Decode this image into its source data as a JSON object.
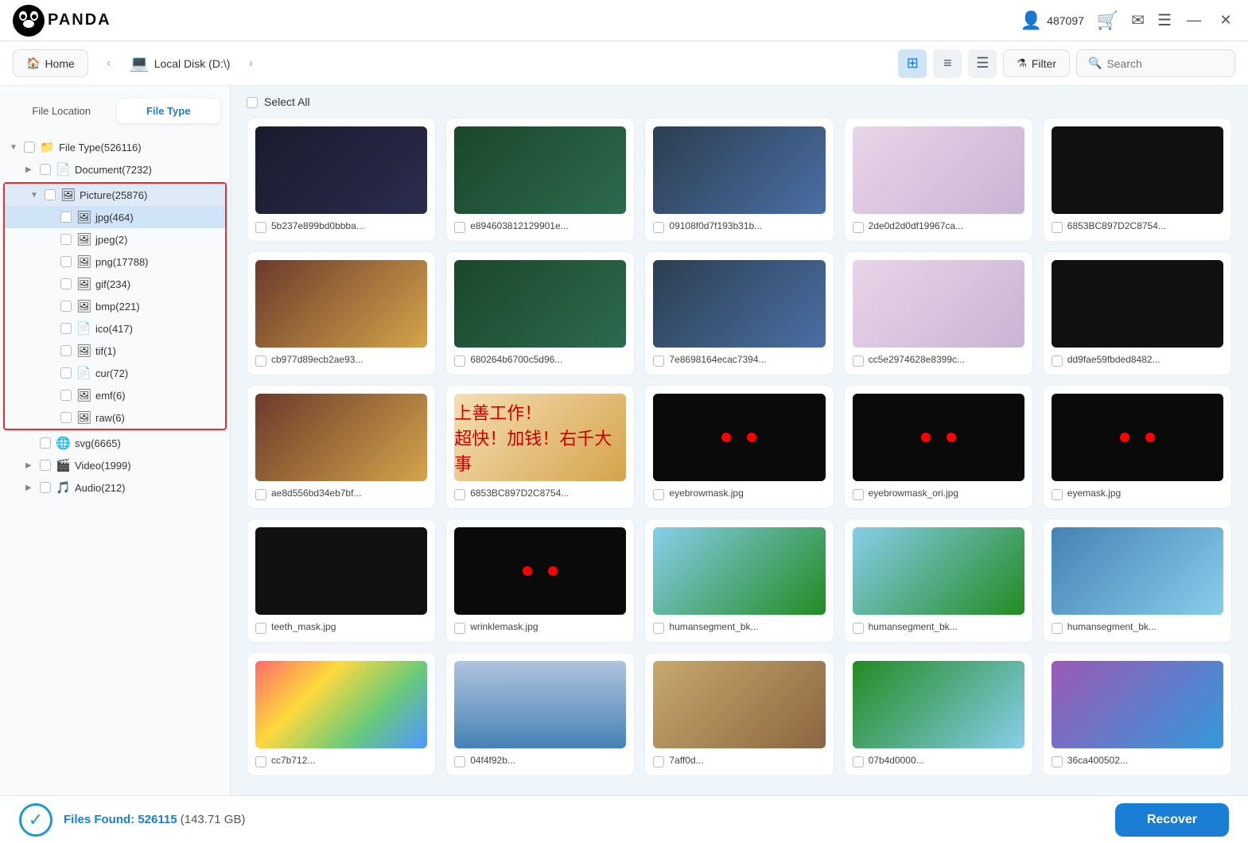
{
  "titlebar": {
    "logo_text": "PANDA",
    "user_id": "487097",
    "cart_icon": "🛒",
    "email_icon": "✉",
    "menu_icon": "☰",
    "minimize_icon": "—",
    "close_icon": "✕"
  },
  "navbar": {
    "home_label": "Home",
    "location_label": "Local Disk (D:\\)",
    "filter_label": "Filter",
    "search_placeholder": "Search"
  },
  "sidebar": {
    "tab_file_location": "File Location",
    "tab_file_type": "File Type",
    "tree": [
      {
        "id": "root",
        "label": "File Type(526116)",
        "indent": 0,
        "icon": "📁",
        "arrow": "▼",
        "color": "#f5c518"
      },
      {
        "id": "document",
        "label": "Document(7232)",
        "indent": 1,
        "icon": "📄",
        "arrow": "▶",
        "color": "#f5a623"
      },
      {
        "id": "picture",
        "label": "Picture(25876)",
        "indent": 1,
        "icon": "🖼",
        "arrow": "▼",
        "color": "#4a90d9",
        "selected": true
      },
      {
        "id": "jpg",
        "label": "jpg(464)",
        "indent": 2,
        "icon": "🖼",
        "highlighted": true
      },
      {
        "id": "jpeg",
        "label": "jpeg(2)",
        "indent": 2,
        "icon": "🖼"
      },
      {
        "id": "png",
        "label": "png(17788)",
        "indent": 2,
        "icon": "🖼",
        "color": "#4caf50"
      },
      {
        "id": "gif",
        "label": "gif(234)",
        "indent": 2,
        "icon": "🖼"
      },
      {
        "id": "bmp",
        "label": "bmp(221)",
        "indent": 2,
        "icon": "🖼"
      },
      {
        "id": "ico",
        "label": "ico(417)",
        "indent": 2,
        "icon": "📄"
      },
      {
        "id": "tif",
        "label": "tif(1)",
        "indent": 2,
        "icon": "🖼",
        "color": "#f5c518"
      },
      {
        "id": "cur",
        "label": "cur(72)",
        "indent": 2,
        "icon": "📄"
      },
      {
        "id": "emf",
        "label": "emf(6)",
        "indent": 2,
        "icon": "🖼"
      },
      {
        "id": "raw",
        "label": "raw(6)",
        "indent": 2,
        "icon": "🖼",
        "color": "#4a90d9"
      },
      {
        "id": "svg",
        "label": "svg(6665)",
        "indent": 1,
        "icon": "🌐",
        "color": "#e44d26"
      },
      {
        "id": "video",
        "label": "Video(1999)",
        "indent": 1,
        "icon": "🎬",
        "arrow": "▶",
        "color": "#9b59b6"
      },
      {
        "id": "audio",
        "label": "Audio(212)",
        "indent": 1,
        "icon": "🎵",
        "arrow": "▶",
        "color": "#e74c3c"
      }
    ]
  },
  "content": {
    "select_all_label": "Select All",
    "files": [
      {
        "name": "5b237e899bd0bbba...",
        "style": "img-dark"
      },
      {
        "name": "e894603812129901e...",
        "style": "img-nature"
      },
      {
        "name": "09108f0d7f193b31b...",
        "style": "img-city"
      },
      {
        "name": "2de0d2d0df19967ca...",
        "style": "img-abstract"
      },
      {
        "name": "6853BC897D2C8754...",
        "style": "img-black"
      },
      {
        "name": "cb977d89ecb2ae93...",
        "style": "img-art"
      },
      {
        "name": "680264b6700c5d96...",
        "style": "img-nature"
      },
      {
        "name": "7e8698164ecac7394...",
        "style": "img-city"
      },
      {
        "name": "cc5e2974628e8399c...",
        "style": "img-abstract"
      },
      {
        "name": "dd9fae59fbded8482...",
        "style": "img-black"
      },
      {
        "name": "ae8d556bd34eb7bf...",
        "style": "img-art"
      },
      {
        "name": "6853BC897D2C8754...",
        "style": "img-chinese"
      },
      {
        "name": "eyebrowmask.jpg",
        "style": "img-red-eyes"
      },
      {
        "name": "eyebrowmask_ori.jpg",
        "style": "img-red-eyes"
      },
      {
        "name": "eyemask.jpg",
        "style": "img-red-eyes"
      },
      {
        "name": "teeth_mask.jpg",
        "style": "img-black"
      },
      {
        "name": "wrinklemask.jpg",
        "style": "img-red-eyes"
      },
      {
        "name": "humansegment_bk...",
        "style": "img-mountain"
      },
      {
        "name": "humansegment_bk...",
        "style": "img-mountain"
      },
      {
        "name": "humansegment_bk...",
        "style": "img-lake"
      },
      {
        "name": "cc7b712...",
        "style": "img-colorful"
      },
      {
        "name": "04f4f92b...",
        "style": "img-whale"
      },
      {
        "name": "7aff0d...",
        "style": "img-road"
      },
      {
        "name": "07b4d0000...",
        "style": "img-landscape"
      },
      {
        "name": "36ca400502...",
        "style": "img-fantasy"
      }
    ]
  },
  "bottombar": {
    "files_found_label": "Files Found:",
    "files_count": "526115",
    "files_size": "(143.71 GB)",
    "recover_label": "Recover"
  }
}
